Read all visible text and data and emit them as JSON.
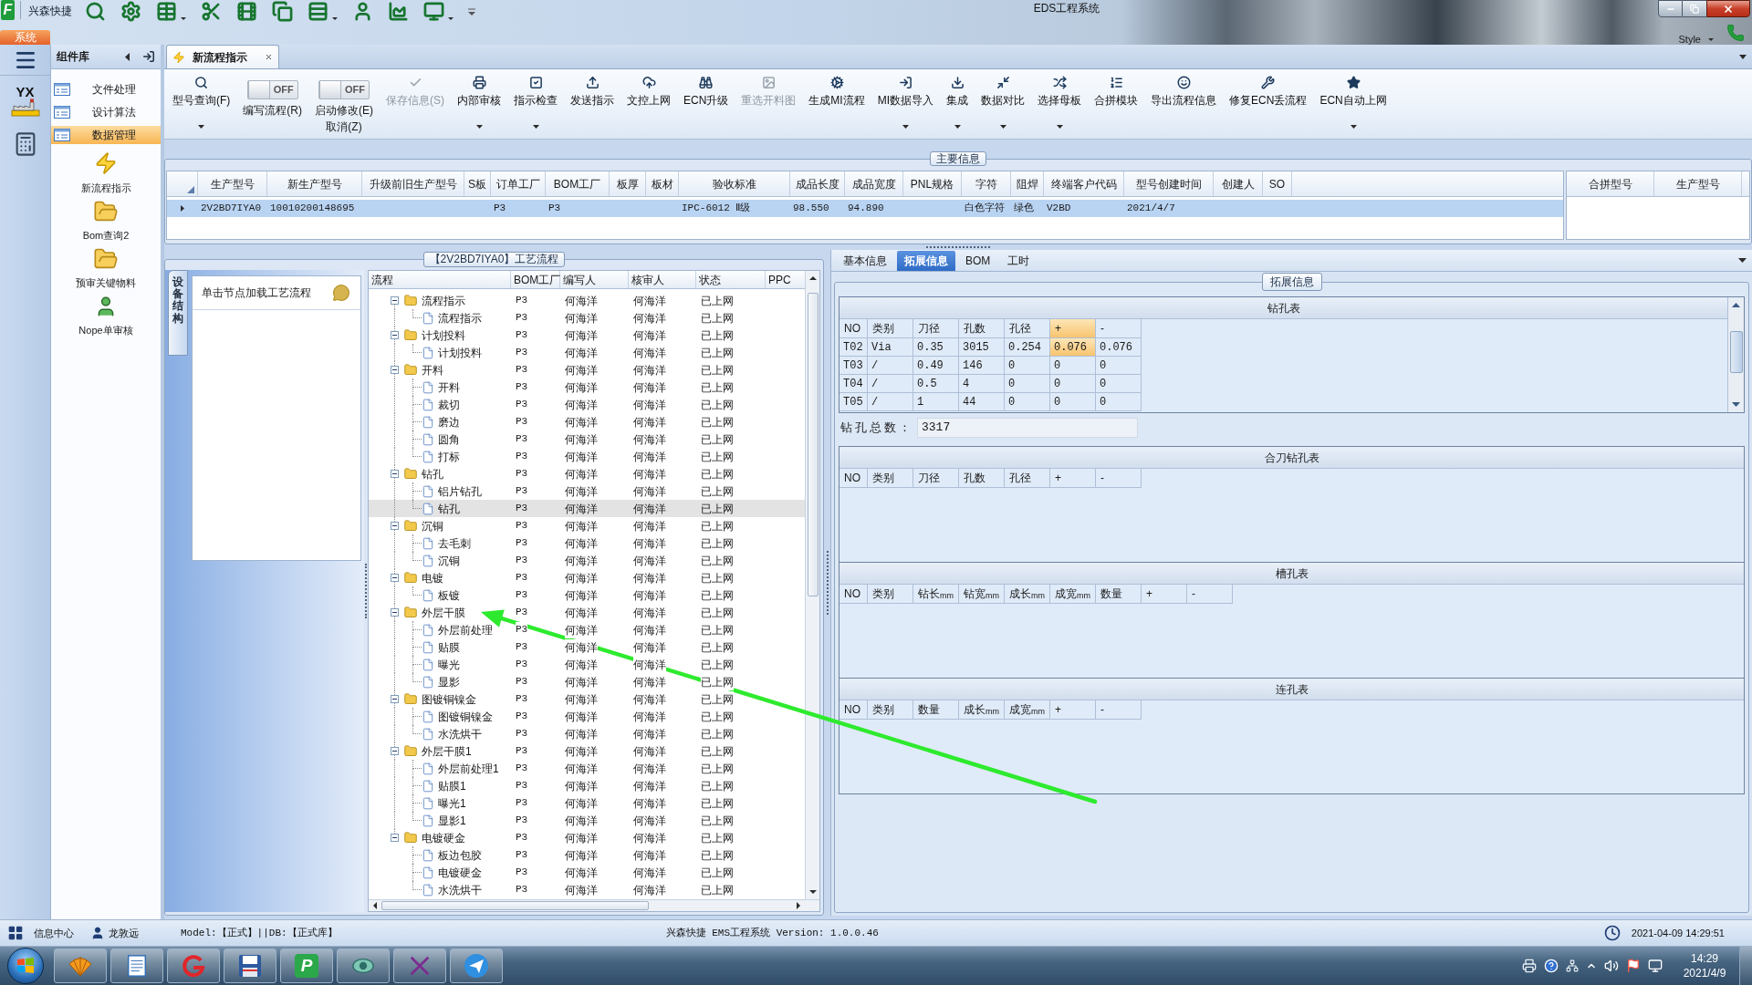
{
  "title_bar": {
    "logo_text": "F",
    "app_name": "兴森快捷",
    "title": "EDS工程系统",
    "style_label": "Style"
  },
  "system_tab": {
    "label": "系统",
    "selected": true
  },
  "left_strip": {
    "logo_text": "YX"
  },
  "sidebar": {
    "title": "组件库",
    "items": [
      {
        "label": "文件处理",
        "selected": false
      },
      {
        "label": "设计算法",
        "selected": false
      },
      {
        "label": "数据管理",
        "selected": true
      }
    ],
    "shortcuts": [
      "新流程指示",
      "Bom查询2",
      "预审关键物料",
      "Nope单审核"
    ]
  },
  "doc_tabs": [
    {
      "label": "新流程指示",
      "selected": true
    }
  ],
  "toolbar": [
    {
      "kind": "button",
      "label": "型号查询(F)",
      "has_menu": true,
      "disabled": false
    },
    {
      "kind": "toggle",
      "label": "编写流程(R)",
      "switch_text": "OFF",
      "on": false
    },
    {
      "kind": "toggle",
      "label": "启动修改(E)",
      "sublabel": "取消(Z)",
      "switch_text": "OFF",
      "on": false
    },
    {
      "kind": "button",
      "label": "保存信息(S)",
      "has_menu": false,
      "disabled": true
    },
    {
      "kind": "button",
      "label": "内部审核",
      "has_menu": true,
      "disabled": false
    },
    {
      "kind": "button",
      "label": "指示检查",
      "has_menu": true,
      "disabled": false
    },
    {
      "kind": "button",
      "label": "发送指示",
      "has_menu": false,
      "disabled": false
    },
    {
      "kind": "button",
      "label": "文控上网",
      "has_menu": false,
      "disabled": false
    },
    {
      "kind": "button",
      "label": "ECN升级",
      "has_menu": false,
      "disabled": false
    },
    {
      "kind": "button",
      "label": "重选开料图",
      "has_menu": false,
      "disabled": true
    },
    {
      "kind": "button",
      "label": "生成MI流程",
      "has_menu": false,
      "disabled": false
    },
    {
      "kind": "button",
      "label": "MI数据导入",
      "has_menu": true,
      "disabled": false
    },
    {
      "kind": "button",
      "label": "集成",
      "has_menu": true,
      "disabled": false
    },
    {
      "kind": "button",
      "label": "数据对比",
      "has_menu": true,
      "disabled": false
    },
    {
      "kind": "button",
      "label": "选择母板",
      "has_menu": true,
      "disabled": false
    },
    {
      "kind": "button",
      "label": "合拼模块",
      "has_menu": false,
      "disabled": false
    },
    {
      "kind": "button",
      "label": "导出流程信息",
      "has_menu": false,
      "disabled": false
    },
    {
      "kind": "button",
      "label": "修复ECN丢流程",
      "has_menu": false,
      "disabled": false
    },
    {
      "kind": "button",
      "label": "ECN自动上网",
      "has_menu": true,
      "disabled": false
    }
  ],
  "main_info": {
    "title": "主要信息",
    "columns": [
      "生产型号",
      "新生产型号",
      "升级前旧生产型号",
      "S板",
      "订单工厂",
      "BOM工厂",
      "板厚",
      "板材",
      "验收标准",
      "成品长度",
      "成品宽度",
      "PNL规格",
      "字符",
      "阻焊",
      "终端客户代码",
      "型号创建时间",
      "创建人",
      "SO"
    ],
    "rows": [
      {
        "selected": true,
        "cells": [
          "2V2BD7IYA0",
          "10010200148695",
          null,
          null,
          "P3",
          "P3",
          null,
          null,
          "IPC-6012 Ⅱ级",
          "98.550",
          "94.890",
          null,
          "白色字符",
          "绿色",
          "V2BD",
          "2021/4/7",
          null,
          null
        ]
      }
    ],
    "side_columns": [
      "合拼型号",
      "生产型号"
    ]
  },
  "process": {
    "title": "【2V2BD7IYA0】工艺流程",
    "side_tab": "设备结构",
    "hint": "单击节点加载工艺流程",
    "columns": [
      "流程",
      "BOM工厂",
      "编写人",
      "核审人",
      "状态",
      "PPC"
    ],
    "rows": [
      {
        "name": "流程指示",
        "bom_factory": "P3",
        "writer": "何海洋",
        "reviewer": "何海洋",
        "status": "已上网",
        "selected": false,
        "expanded": true,
        "children": [
          {
            "name": "流程指示",
            "bom_factory": "P3",
            "writer": "何海洋",
            "reviewer": "何海洋",
            "status": "已上网",
            "selected": false
          }
        ]
      },
      {
        "name": "计划投料",
        "bom_factory": "P3",
        "writer": "何海洋",
        "reviewer": "何海洋",
        "status": "已上网",
        "selected": false,
        "expanded": true,
        "children": [
          {
            "name": "计划投料",
            "bom_factory": "P3",
            "writer": "何海洋",
            "reviewer": "何海洋",
            "status": "已上网",
            "selected": false
          }
        ]
      },
      {
        "name": "开料",
        "bom_factory": "P3",
        "writer": "何海洋",
        "reviewer": "何海洋",
        "status": "已上网",
        "selected": false,
        "expanded": true,
        "children": [
          {
            "name": "开料",
            "bom_factory": "P3",
            "writer": "何海洋",
            "reviewer": "何海洋",
            "status": "已上网",
            "selected": false
          },
          {
            "name": "裁切",
            "bom_factory": "P3",
            "writer": "何海洋",
            "reviewer": "何海洋",
            "status": "已上网",
            "selected": false
          },
          {
            "name": "磨边",
            "bom_factory": "P3",
            "writer": "何海洋",
            "reviewer": "何海洋",
            "status": "已上网",
            "selected": false
          },
          {
            "name": "圆角",
            "bom_factory": "P3",
            "writer": "何海洋",
            "reviewer": "何海洋",
            "status": "已上网",
            "selected": false
          },
          {
            "name": "打标",
            "bom_factory": "P3",
            "writer": "何海洋",
            "reviewer": "何海洋",
            "status": "已上网",
            "selected": false
          }
        ]
      },
      {
        "name": "钻孔",
        "bom_factory": "P3",
        "writer": "何海洋",
        "reviewer": "何海洋",
        "status": "已上网",
        "selected": false,
        "expanded": true,
        "children": [
          {
            "name": "铝片钻孔",
            "bom_factory": "P3",
            "writer": "何海洋",
            "reviewer": "何海洋",
            "status": "已上网",
            "selected": false
          },
          {
            "name": "钻孔",
            "bom_factory": "P3",
            "writer": "何海洋",
            "reviewer": "何海洋",
            "status": "已上网",
            "selected": true
          }
        ]
      },
      {
        "name": "沉铜",
        "bom_factory": "P3",
        "writer": "何海洋",
        "reviewer": "何海洋",
        "status": "已上网",
        "selected": false,
        "expanded": true,
        "children": [
          {
            "name": "去毛刺",
            "bom_factory": "P3",
            "writer": "何海洋",
            "reviewer": "何海洋",
            "status": "已上网",
            "selected": false
          },
          {
            "name": "沉铜",
            "bom_factory": "P3",
            "writer": "何海洋",
            "reviewer": "何海洋",
            "status": "已上网",
            "selected": false
          }
        ]
      },
      {
        "name": "电镀",
        "bom_factory": "P3",
        "writer": "何海洋",
        "reviewer": "何海洋",
        "status": "已上网",
        "selected": false,
        "expanded": true,
        "children": [
          {
            "name": "板镀",
            "bom_factory": "P3",
            "writer": "何海洋",
            "reviewer": "何海洋",
            "status": "已上网",
            "selected": false
          }
        ]
      },
      {
        "name": "外层干膜",
        "bom_factory": "P3",
        "writer": "何海洋",
        "reviewer": "何海洋",
        "status": "已上网",
        "selected": false,
        "expanded": true,
        "children": [
          {
            "name": "外层前处理",
            "bom_factory": "P3",
            "writer": "何海洋",
            "reviewer": "何海洋",
            "status": "已上网",
            "selected": false
          },
          {
            "name": "贴膜",
            "bom_factory": "P3",
            "writer": "何海洋",
            "reviewer": "何海洋",
            "status": "已上网",
            "selected": false
          },
          {
            "name": "曝光",
            "bom_factory": "P3",
            "writer": "何海洋",
            "reviewer": "何海洋",
            "status": "已上网",
            "selected": false
          },
          {
            "name": "显影",
            "bom_factory": "P3",
            "writer": "何海洋",
            "reviewer": "何海洋",
            "status": "已上网",
            "selected": false
          }
        ]
      },
      {
        "name": "图镀铜镍金",
        "bom_factory": "P3",
        "writer": "何海洋",
        "reviewer": "何海洋",
        "status": "已上网",
        "selected": false,
        "expanded": true,
        "children": [
          {
            "name": "图镀铜镍金",
            "bom_factory": "P3",
            "writer": "何海洋",
            "reviewer": "何海洋",
            "status": "已上网",
            "selected": false
          },
          {
            "name": "水洗烘干",
            "bom_factory": "P3",
            "writer": "何海洋",
            "reviewer": "何海洋",
            "status": "已上网",
            "selected": false
          }
        ]
      },
      {
        "name": "外层干膜1",
        "bom_factory": "P3",
        "writer": "何海洋",
        "reviewer": "何海洋",
        "status": "已上网",
        "selected": false,
        "expanded": true,
        "children": [
          {
            "name": "外层前处理1",
            "bom_factory": "P3",
            "writer": "何海洋",
            "reviewer": "何海洋",
            "status": "已上网",
            "selected": false
          },
          {
            "name": "贴膜1",
            "bom_factory": "P3",
            "writer": "何海洋",
            "reviewer": "何海洋",
            "status": "已上网",
            "selected": false
          },
          {
            "name": "曝光1",
            "bom_factory": "P3",
            "writer": "何海洋",
            "reviewer": "何海洋",
            "status": "已上网",
            "selected": false
          },
          {
            "name": "显影1",
            "bom_factory": "P3",
            "writer": "何海洋",
            "reviewer": "何海洋",
            "status": "已上网",
            "selected": false
          }
        ]
      },
      {
        "name": "电镀硬金",
        "bom_factory": "P3",
        "writer": "何海洋",
        "reviewer": "何海洋",
        "status": "已上网",
        "selected": false,
        "expanded": true,
        "children": [
          {
            "name": "板边包胶",
            "bom_factory": "P3",
            "writer": "何海洋",
            "reviewer": "何海洋",
            "status": "已上网",
            "selected": false
          },
          {
            "name": "电镀硬金",
            "bom_factory": "P3",
            "writer": "何海洋",
            "reviewer": "何海洋",
            "status": "已上网",
            "selected": false
          },
          {
            "name": "水洗烘干",
            "bom_factory": "P3",
            "writer": "何海洋",
            "reviewer": "何海洋",
            "status": "已上网",
            "selected": false
          }
        ]
      }
    ]
  },
  "detail": {
    "tabs": [
      {
        "label": "基本信息",
        "selected": false
      },
      {
        "label": "拓展信息",
        "selected": true
      },
      {
        "label": "BOM",
        "selected": false
      },
      {
        "label": "工时",
        "selected": false
      }
    ],
    "group_title": "拓展信息",
    "drill_table": {
      "title": "钻孔表",
      "columns": [
        {
          "label": "NO",
          "selected": false
        },
        {
          "label": "类别",
          "selected": false
        },
        {
          "label": "刀径",
          "selected": false
        },
        {
          "label": "孔数",
          "selected": false
        },
        {
          "label": "孔径",
          "selected": false
        },
        {
          "label": "+",
          "selected": true
        },
        {
          "label": "-",
          "selected": false
        }
      ],
      "rows": [
        {
          "selected": true,
          "cells": [
            "T02",
            "Via",
            "0.35",
            "3015",
            "0.254",
            "0.076",
            "0.076"
          ]
        },
        {
          "selected": false,
          "cells": [
            "T03",
            "/",
            "0.49",
            "146",
            "0",
            "0",
            "0"
          ]
        },
        {
          "selected": false,
          "cells": [
            "T04",
            "/",
            "0.5",
            "4",
            "0",
            "0",
            "0"
          ]
        },
        {
          "selected": false,
          "cells": [
            "T05",
            "/",
            "1",
            "44",
            "0",
            "0",
            "0"
          ]
        }
      ]
    },
    "total": {
      "label": "钻孔总数：",
      "value": "3317"
    },
    "tables": [
      {
        "title": "合刀钻孔表",
        "columns": [
          "NO",
          "类别",
          "刀径",
          "孔数",
          "孔径",
          "+",
          "-"
        ]
      },
      {
        "title": "槽孔表",
        "columns": [
          "NO",
          "类别",
          "钻长$_{mm}$",
          "钻宽$_{mm}$",
          "成长$_{mm}$",
          "成宽$_{mm}$",
          "数量",
          "+",
          "-"
        ]
      },
      {
        "title": "连孔表",
        "columns": [
          "NO",
          "类别",
          "数量",
          "成长$_{mm}$",
          "成宽$_{mm}$",
          "+",
          "-"
        ]
      }
    ]
  },
  "status_bar": {
    "info_center": "信息中心",
    "user": "龙敦远",
    "model": "Model:【正式】||DB:【正式库】",
    "version": "兴森快捷 EMS工程系统 Version: 1.0.0.46",
    "datetime": "2021-04-09 14:29:51"
  },
  "taskbar": {
    "app_badge": "P",
    "time": "14:29",
    "date": "2021/4/9"
  }
}
